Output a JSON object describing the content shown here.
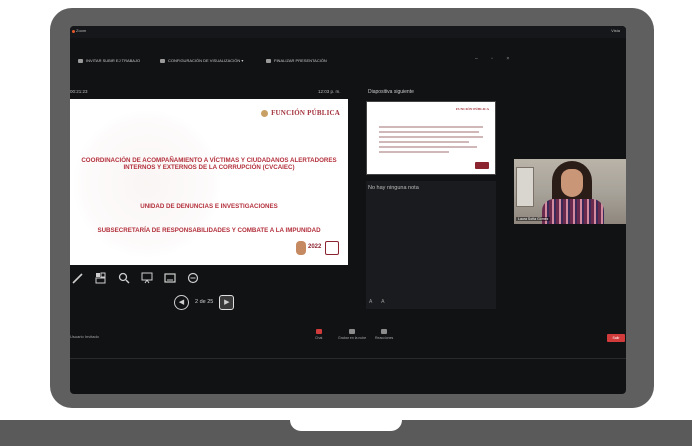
{
  "window": {
    "app_name": "Zoom",
    "top_right": "Vista"
  },
  "toolbar": {
    "items": [
      {
        "icon": "share-icon",
        "label": "INVITAR SUBIR EJ TRABAJO"
      },
      {
        "icon": "phone-icon",
        "label": "CONFIGURACIÓN DE VISUALIZACIÓN ▾"
      },
      {
        "icon": "presentation-icon",
        "label": "FINALIZAR PRESENTACIÓN"
      }
    ],
    "window_controls": "– ▫ ×"
  },
  "status": {
    "elapsed": "00:21:23",
    "clock": "12:03 p. m.",
    "next_slide_label": "Diapositiva siguiente"
  },
  "slide": {
    "logo_text": "FUNCIÓN PÚBLICA",
    "line1": "COORDINACIÓN DE ACOMPAÑAMIENTO A VÍCTIMAS Y CIUDADANOS ALERTADORES INTERNOS Y EXTERNOS DE LA CORRUPCIÓN (CVCAIEC)",
    "line2": "UNIDAD DE DENUNCIAS E INVESTIGACIONES",
    "line3": "SUBSECRETARÍA DE RESPONSABILIDADES Y COMBATE A LA IMPUNIDAD",
    "sticker_year": "2022"
  },
  "slide_tools": [
    "pen-icon",
    "slide-grid-icon",
    "zoom-icon",
    "pointer-icon",
    "subtitles-icon",
    "more-options-icon"
  ],
  "pager": {
    "text": "2 de 25",
    "prev": "◀",
    "next": "▶"
  },
  "notes": {
    "text": "No hay ninguna nota",
    "zoom_controls": "A A"
  },
  "video": {
    "participant_name": "Laura Sofía Gómez"
  },
  "bottombar": {
    "left_text": "Usuario Invitado",
    "items": [
      {
        "icon": "chat-icon",
        "label": "Chat"
      },
      {
        "icon": "record-icon",
        "label": "Grabar en la nube"
      },
      {
        "icon": "reactions-icon",
        "label": "Reacciones"
      }
    ],
    "end_label": "Salir"
  },
  "colors": {
    "slide_red": "#b3303c",
    "end_red": "#d23b3b",
    "laptop_gray": "#5f5f5f"
  }
}
